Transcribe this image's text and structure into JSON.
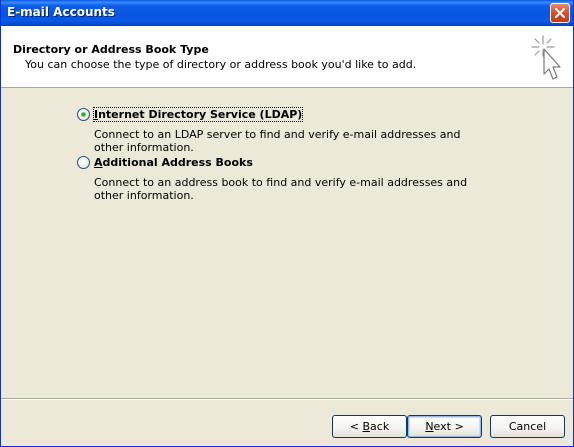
{
  "window": {
    "title": "E-mail Accounts"
  },
  "header": {
    "title": "Directory or Address Book Type",
    "subtitle": "You can choose the type of directory or address book you'd like to add."
  },
  "options": [
    {
      "label_accel": "I",
      "label_rest": "nternet Directory Service (LDAP)",
      "description": "Connect to an LDAP server to find and verify e-mail addresses and other information.",
      "selected": true
    },
    {
      "label_accel": "A",
      "label_rest": "dditional Address Books",
      "description": "Connect to an address book to find and verify e-mail addresses and other information.",
      "selected": false
    }
  ],
  "buttons": {
    "back_prefix": "< ",
    "back_accel": "B",
    "back_rest": "ack",
    "next_accel": "N",
    "next_rest": "ext >",
    "cancel": "Cancel"
  },
  "colors": {
    "titlebar": "#0654e0",
    "window_bg": "#ece9d8",
    "header_bg": "#ffffff",
    "radio_selected": "#21a121"
  },
  "icons": {
    "close": "close-icon",
    "wizard": "wizard-cursor-icon"
  }
}
